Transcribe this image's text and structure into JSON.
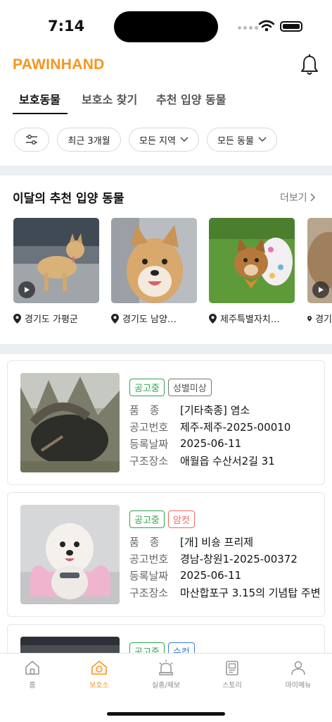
{
  "status": {
    "time": "7:14"
  },
  "header": {
    "logo": "PAWINHAND"
  },
  "tabs": [
    {
      "label": "보호동물",
      "active": true
    },
    {
      "label": "보호소 찾기",
      "active": false
    },
    {
      "label": "추천 입양 동물",
      "active": false
    }
  ],
  "filters": {
    "period": "최근 3개월",
    "region": "모든 지역",
    "species": "모든 동물"
  },
  "recommended": {
    "title": "이달의 추천 입양 동물",
    "more": "더보기",
    "items": [
      {
        "location": "경기도 가평군"
      },
      {
        "location": "경기도 남양…"
      },
      {
        "location": "제주특별자치…"
      },
      {
        "location": "경기"
      }
    ]
  },
  "labels": {
    "breed": "품　종",
    "notice_no": "공고번호",
    "reg_date": "등록날짜",
    "rescue_place": "구조장소"
  },
  "animals": [
    {
      "status": "공고중",
      "sex": "성별미상",
      "breed": "[기타축종] 염소",
      "notice_no": "제주-제주-2025-00010",
      "reg_date": "2025-06-11",
      "rescue_place": "애월읍 수산서2길 31"
    },
    {
      "status": "공고중",
      "sex": "암컷",
      "breed": "[개] 비숑 프리제",
      "notice_no": "경남-창원1-2025-00372",
      "reg_date": "2025-06-11",
      "rescue_place": "마산합포구 3.15의 기념탑 주변"
    },
    {
      "status": "공고중",
      "sex": "수컷"
    }
  ],
  "nav": [
    {
      "label": "홈",
      "icon": "home-icon"
    },
    {
      "label": "보호소",
      "icon": "shelter-icon",
      "active": true
    },
    {
      "label": "실종/제보",
      "icon": "siren-icon"
    },
    {
      "label": "스토리",
      "icon": "story-icon"
    },
    {
      "label": "마이메뉴",
      "icon": "person-icon"
    }
  ],
  "colors": {
    "brand": "#f7941d",
    "status_green": "#2ea44f",
    "female_red": "#f06a5c",
    "male_blue": "#3c78d8"
  }
}
